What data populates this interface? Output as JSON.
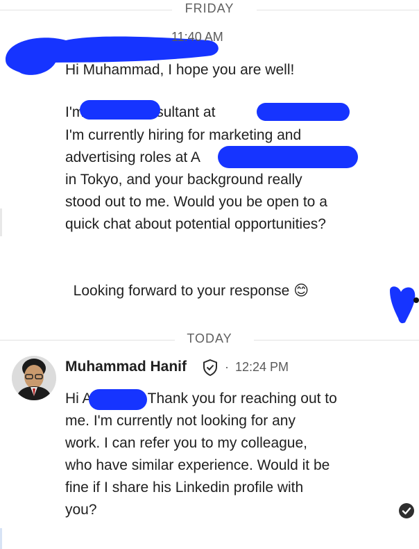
{
  "dividers": {
    "first": "FRIDAY",
    "second": "TODAY"
  },
  "first_message": {
    "time": "11:40 AM",
    "lines": [
      "Hi Muhammad, I hope you are well!",
      "",
      "I'm            consultant at",
      "I'm currently hiring for marketing and",
      "advertising roles at A",
      "in Tokyo, and your background really",
      "stood out to me. Would you be open to a",
      "quick chat about potential opportunities?",
      "",
      "Looking forward to your response"
    ],
    "emoji": "😊"
  },
  "reply": {
    "sender": "Muhammad Hanif",
    "verified_icon": "shield-check-icon",
    "separator": "·",
    "time": "12:24 PM",
    "lines": [
      "Hi A              Thank you for reaching out to",
      "me. I'm currently not looking for any",
      "work. I can refer you to my colleague,",
      "who have similar experience. Would it be",
      "fine if I share his Linkedin profile with",
      "you?"
    ]
  },
  "colors": {
    "redaction": "#1634ff",
    "divider_text": "#5f5f5f"
  }
}
